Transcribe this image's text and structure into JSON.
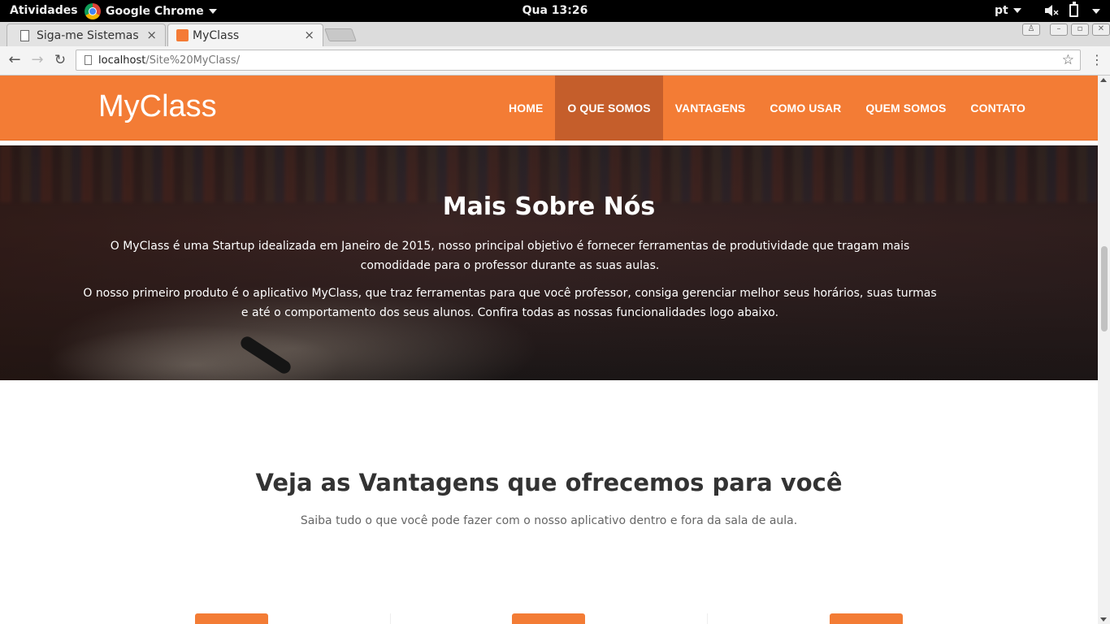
{
  "topbar": {
    "activities": "Atividades",
    "app_name": "Google Chrome",
    "clock": "Qua 13:26",
    "lang": "pt"
  },
  "tabs": [
    {
      "title": "Siga-me Sistemas",
      "close": "×"
    },
    {
      "title": "MyClass",
      "close": "×"
    }
  ],
  "toolbar": {
    "url_host": "localhost",
    "url_path": "/Site%20MyClass/"
  },
  "site": {
    "brand": "MyClass",
    "menu": [
      {
        "label": "HOME"
      },
      {
        "label": "O QUE SOMOS"
      },
      {
        "label": "VANTAGENS"
      },
      {
        "label": "COMO USAR"
      },
      {
        "label": "QUEM SOMOS"
      },
      {
        "label": "CONTATO"
      }
    ],
    "active_menu": "O QUE SOMOS",
    "accent_color": "#f37c35",
    "active_color": "#c55e2b"
  },
  "hero": {
    "title": "Mais Sobre Nós",
    "p1": "O MyClass é uma Startup idealizada em Janeiro de 2015, nosso principal objetivo é fornecer ferramentas de produtividade que tragam mais comodidade para o professor durante as suas aulas.",
    "p2": "O nosso primeiro produto é o aplicativo MyClass, que traz ferramentas para que você professor, consiga gerenciar melhor seus horários, suas turmas e até o comportamento dos seus alunos. Confira todas as nossas funcionalidades logo abaixo."
  },
  "advantages": {
    "title": "Veja as Vantagens que ofrecemos para você",
    "subtitle": "Saiba tudo o que você pode fazer com o nosso aplicativo dentro e fora da sala de aula."
  }
}
